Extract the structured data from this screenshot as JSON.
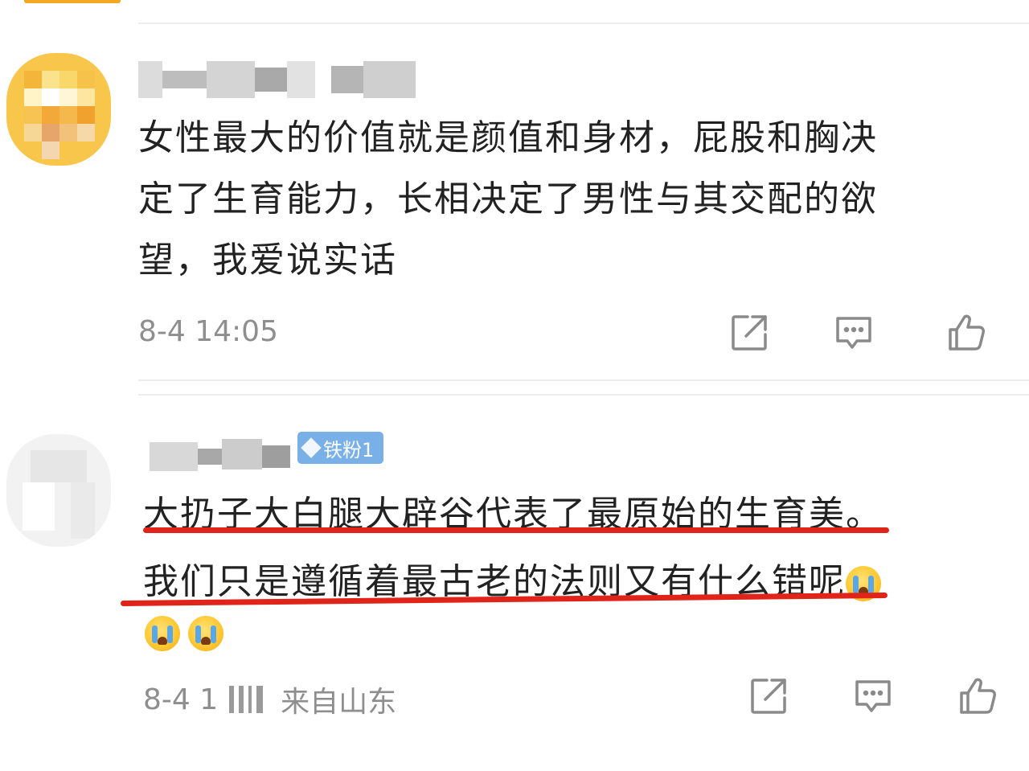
{
  "comments": [
    {
      "avatar": "avatar-icon",
      "username": "█ █ █ █",
      "text_lines": [
        "女性最大的价值就是颜值和身材，屁股和胸决",
        "定了生育能力，长相决定了男性与其交配的欲",
        "望，我爱说实话"
      ],
      "time": "8-4 14:05",
      "actions": [
        "share-icon",
        "comment-icon",
        "like-icon"
      ]
    },
    {
      "avatar": "avatar-icon",
      "username": "█ █ █",
      "badge": "铁粉1",
      "text_lines": [
        "大扔子大白腿大辟谷代表了最原始的生育美。",
        "我们只是遵循着最古老的法则又有什么错呢"
      ],
      "emoji_count": 3,
      "time": "8-4 1",
      "location": "来自山东",
      "actions": [
        "share-icon",
        "comment-icon",
        "like-icon"
      ]
    }
  ],
  "colors": {
    "text": "#222222",
    "meta": "#8e8e8e",
    "badge": "#7ab0e8",
    "underline": "#e0241a",
    "accent": "#f5a623"
  }
}
